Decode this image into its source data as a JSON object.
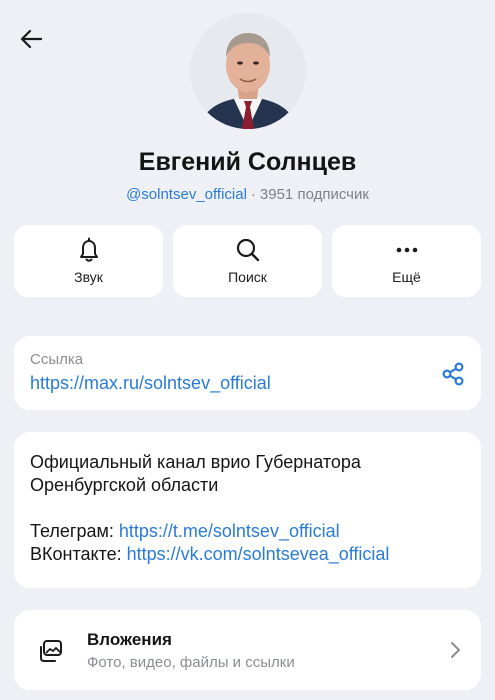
{
  "profile": {
    "name": "Евгений Солнцев",
    "handle": "@solntsev_official",
    "separator": "·",
    "subscribers": "3951 подписчик"
  },
  "actions": [
    {
      "label": "Звук",
      "icon": "bell-icon"
    },
    {
      "label": "Поиск",
      "icon": "search-icon"
    },
    {
      "label": "Ещё",
      "icon": "more-icon"
    }
  ],
  "link": {
    "label": "Ссылка",
    "url": "https://max.ru/solntsev_official",
    "icon": "share-icon"
  },
  "description": {
    "line1": "Официальный канал врио Губернатора",
    "line2": "Оренбургской области",
    "telegram_label": "Телеграм: ",
    "telegram_url": "https://t.me/solntsev_official",
    "vk_label": "ВКонтакте: ",
    "vk_url": "https://vk.com/solntsevea_official"
  },
  "attachments": {
    "title": "Вложения",
    "subtitle": "Фото, видео, файлы и ссылки"
  },
  "colors": {
    "background": "#eef0f5",
    "accent": "#2a7bd6",
    "card": "#ffffff",
    "muted": "#8a8d93"
  }
}
